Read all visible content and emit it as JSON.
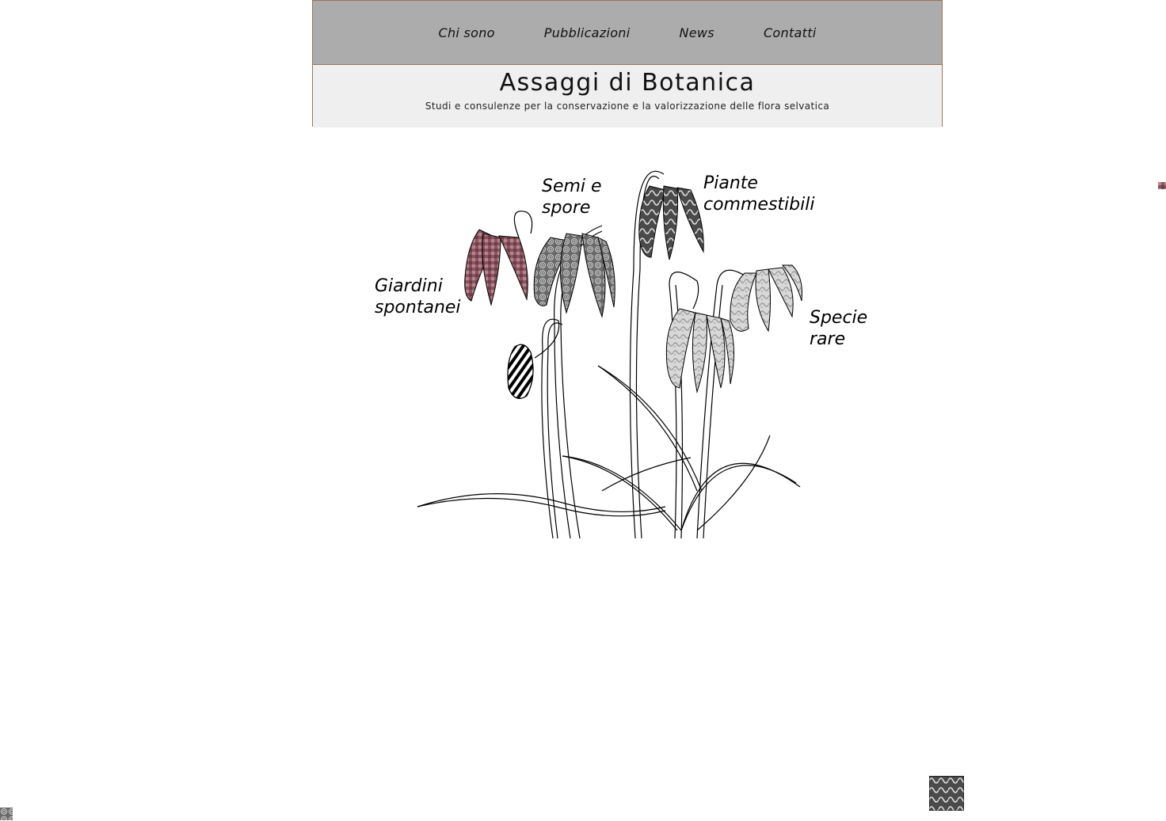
{
  "nav": {
    "items": [
      {
        "label": "Chi sono"
      },
      {
        "label": "Pubblicazioni"
      },
      {
        "label": "News"
      },
      {
        "label": "Contatti"
      }
    ]
  },
  "header": {
    "title": "Assaggi di Botanica",
    "tagline": "Studi e consulenze per la conservazione e la valorizzazione delle flora selvatica"
  },
  "illustration": {
    "labels": {
      "giardini": {
        "line1": "Giardini",
        "line2": "spontanei"
      },
      "semi": {
        "line1": "Semi e",
        "line2": "spore"
      },
      "piante": {
        "line1": "Piante",
        "line2": "commestibili"
      },
      "specie": {
        "line1": "Specie",
        "line2": "rare"
      }
    }
  },
  "colors": {
    "nav_bg": "#acacac",
    "title_bg": "#efefef",
    "border": "#a0725a",
    "flower_mauve": "#8a5560",
    "flower_dark": "#4a4a4a",
    "flower_light": "#b5b5b5"
  }
}
